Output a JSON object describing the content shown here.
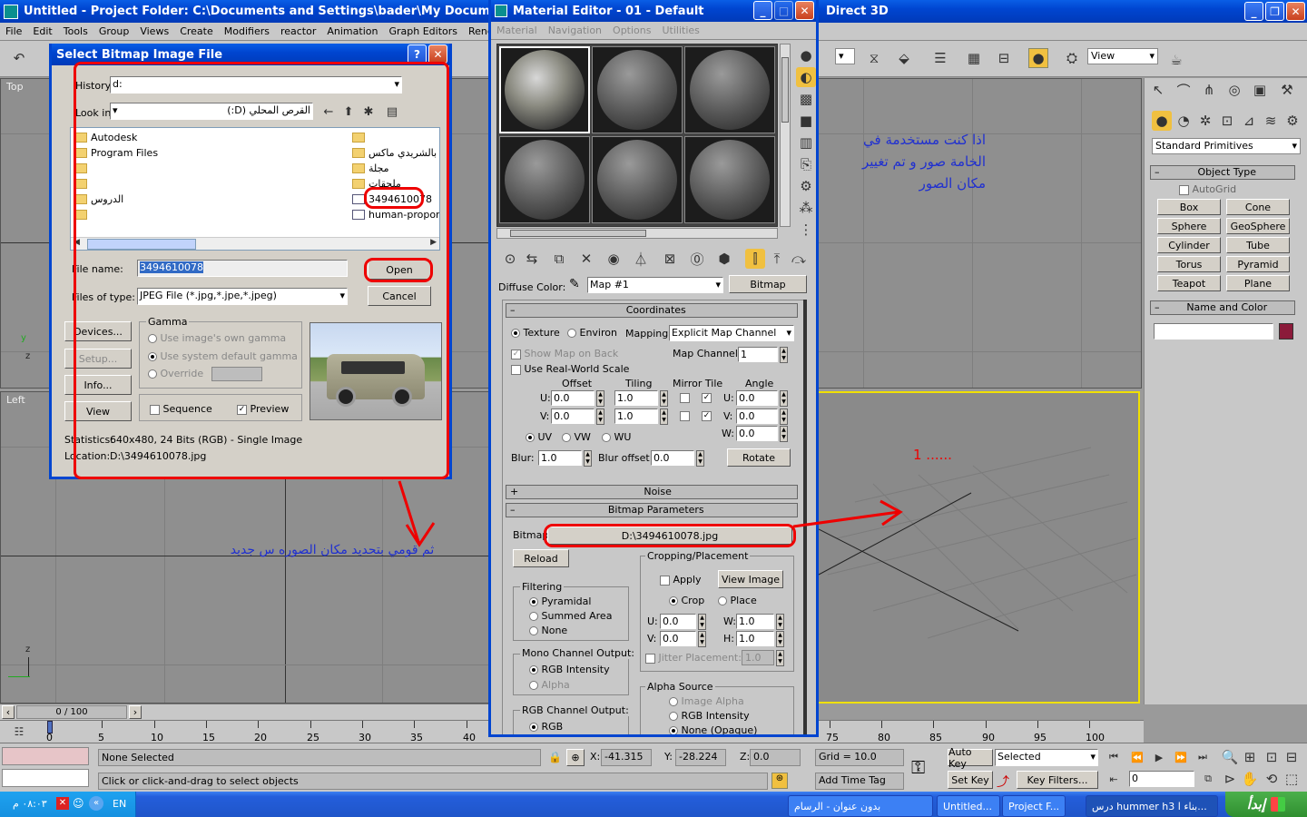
{
  "main_window": {
    "title": "Untitled      - Project Folder: C:\\Documents and Settings\\bader\\My Documer",
    "title_right": "Direct 3D",
    "menu": [
      "File",
      "Edit",
      "Tools",
      "Group",
      "Views",
      "Create",
      "Modifiers",
      "reactor",
      "Animation",
      "Graph Editors",
      "Rendering",
      "Cus"
    ],
    "view_dropdown": "View"
  },
  "viewports": {
    "top": "Top",
    "left": "Left",
    "axis_z": "z",
    "axis_x": "x",
    "axis_y": "y"
  },
  "command_panel": {
    "dropdown": "Standard Primitives",
    "object_type": "Object Type",
    "autogrid": "AutoGrid",
    "buttons": [
      "Box",
      "Cone",
      "Sphere",
      "GeoSphere",
      "Cylinder",
      "Tube",
      "Torus",
      "Pyramid",
      "Teapot",
      "Plane"
    ],
    "name_and_color": "Name and Color",
    "color": "#8b1a3a"
  },
  "timeline": {
    "position": "0 / 100",
    "ticks": [
      "0",
      "5",
      "10",
      "15",
      "20",
      "25",
      "30",
      "35",
      "40",
      "75",
      "80",
      "85",
      "90",
      "95",
      "100"
    ]
  },
  "status": {
    "selection": "None Selected",
    "prompt": "Click or click-and-drag to select objects",
    "x_label": "X:",
    "x_value": "-41.315",
    "y_label": "Y:",
    "y_value": "-28.224",
    "z_label": "Z:",
    "z_value": "0.0",
    "grid": "Grid = 10.0",
    "add_time_tag": "Add Time Tag",
    "auto_key": "Auto Key",
    "set_key": "Set Key",
    "selected": "Selected",
    "key_filters": "Key Filters...",
    "frame": "0"
  },
  "dialog": {
    "title": "Select Bitmap Image File",
    "history_label": "History:",
    "history_value": "d:",
    "lookin_label": "Look in:",
    "lookin_value": "القرص المحلي (D:)",
    "files_left": [
      {
        "name": "Autodesk"
      },
      {
        "name": "Program Files"
      },
      {
        "name": ""
      },
      {
        "name": ""
      },
      {
        "name": "الدروس"
      },
      {
        "name": ""
      }
    ],
    "files_right": [
      {
        "name": ""
      },
      {
        "name": "ق بالشريدي ماكس"
      },
      {
        "name": "مجلة"
      },
      {
        "name": "ملحقات"
      },
      {
        "name": "3494610078"
      },
      {
        "name": "human-proportion"
      }
    ],
    "filename_label": "File name:",
    "filename_value": "3494610078",
    "filetype_label": "Files of type:",
    "filetype_value": "JPEG File (*.jpg,*.jpe,*.jpeg)",
    "open": "Open",
    "cancel": "Cancel",
    "devices": "Devices...",
    "setup": "Setup...",
    "info": "Info...",
    "view": "View",
    "gamma_title": "Gamma",
    "gamma_options": [
      "Use image's own gamma",
      "Use system default gamma",
      "Override"
    ],
    "sequence": "Sequence",
    "preview": "Preview",
    "statistics_label": "Statistics:",
    "statistics_value": "640x480, 24 Bits (RGB) - Single Image",
    "location_label": "Location:",
    "location_value": "D:\\3494610078.jpg"
  },
  "material_editor": {
    "title": "Material Editor - 01 - Default",
    "menu": [
      "Material",
      "Navigation",
      "Options",
      "Utilities"
    ],
    "diffuse_label": "Diffuse Color:",
    "map_value": "Map #1",
    "bitmap_btn": "Bitmap",
    "coordinates": "Coordinates",
    "texture": "Texture",
    "environ": "Environ",
    "mapping_label": "Mapping:",
    "mapping_value": "Explicit Map Channel",
    "show_map": "Show Map on Back",
    "map_channel_label": "Map Channel:",
    "map_channel_value": "1",
    "real_world": "Use Real-World Scale",
    "offset": "Offset",
    "tiling": "Tiling",
    "mirror_tile": "Mirror Tile",
    "angle": "Angle",
    "u": "U:",
    "v": "V:",
    "w": "W:",
    "offset_u": "0.0",
    "offset_v": "0.0",
    "tiling_u": "1.0",
    "tiling_v": "1.0",
    "angle_u": "0.0",
    "angle_v": "0.0",
    "angle_w": "0.0",
    "uv": "UV",
    "vw": "VW",
    "wu": "WU",
    "blur_label": "Blur:",
    "blur_value": "1.0",
    "blur_offset_label": "Blur offset:",
    "blur_offset_value": "0.0",
    "rotate": "Rotate",
    "noise": "Noise",
    "bitmap_params": "Bitmap Parameters",
    "bitmap_label": "Bitmap:",
    "bitmap_path": "D:\\3494610078.jpg",
    "reload": "Reload",
    "cropping": "Cropping/Placement",
    "apply": "Apply",
    "view_image": "View Image",
    "crop": "Crop",
    "place": "Place",
    "cu": "0.0",
    "cv": "0.0",
    "cw": "1.0",
    "ch": "1.0",
    "h": "H:",
    "jitter": "Jitter Placement:",
    "jitter_value": "1.0",
    "filtering": "Filtering",
    "pyramidal": "Pyramidal",
    "summed": "Summed Area",
    "none": "None",
    "mono_output": "Mono Channel Output:",
    "rgb_intensity": "RGB Intensity",
    "alpha": "Alpha",
    "rgb_output": "RGB Channel Output:",
    "rgb": "RGB",
    "alpha_source": "Alpha Source",
    "image_alpha": "Image Alpha",
    "rgb_intensity2": "RGB Intensity",
    "none_opaque": "None (Opaque)"
  },
  "annotations": {
    "top_right": "اذا كنت مستخدمة في الخامة صور و تم تغيير مكان الصور",
    "bottom_left": "ثم قومي بتحديد مكان الصوره س جديد",
    "number": "1 ......"
  },
  "taskbar": {
    "start": "إبدأ",
    "items": [
      "درس hummer h3 بناء ا...",
      "Project F...",
      "Untitled...",
      "بدون عنوان - الرسام"
    ],
    "lang": "EN",
    "clock": "٠٨:٠٣ م"
  }
}
